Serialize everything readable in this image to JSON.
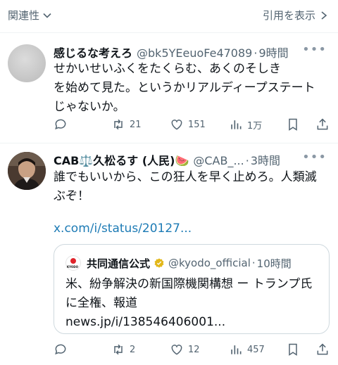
{
  "topbar": {
    "left_label": "関連性",
    "right_label": "引用を表示"
  },
  "tweets": [
    {
      "name": "感じるな考えろ",
      "handle": "@bk5YEeuoFe47089",
      "time": "9時間",
      "text": "せかいせいふくをたくらむ、あくのそしき\nを始めて見た。というかリアルディープステート\nじゃないか。",
      "replies": "",
      "retweets": "21",
      "likes": "151",
      "views": "1万"
    },
    {
      "name": "CAB⚖️久松るす (人民)🍉",
      "handle": "@CAB_...",
      "time": "3時間",
      "text": "誰でもいいから、この狂人を早く止めろ。人類滅\nぶぞ！",
      "link": "x.com/i/status/20127...",
      "replies": "",
      "retweets": "2",
      "likes": "12",
      "views": "457",
      "quote": {
        "name": "共同通信公式",
        "handle": "@kyodo_official",
        "time": "10時間",
        "text": "米、紛争解決の新国際機関構想 ー トランプ氏\nに全権、報道\nnews.jp/i/138546406001..."
      }
    }
  ],
  "colors": {
    "secondary": "#536471",
    "link": "#1d7bb5",
    "border": "#cfd9de",
    "verified": "#e2b719"
  },
  "icons": [
    "chevron-down-icon",
    "chevron-right-icon",
    "more-icon",
    "reply-icon",
    "retweet-icon",
    "like-icon",
    "views-icon",
    "bookmark-icon",
    "share-icon",
    "verified-icon"
  ]
}
